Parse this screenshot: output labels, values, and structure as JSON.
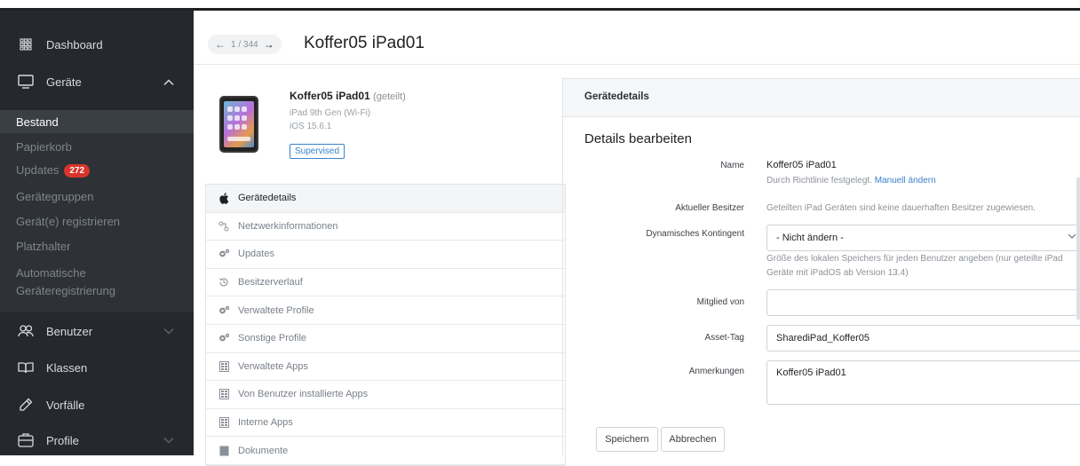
{
  "sidebar": {
    "dashboard": "Dashboard",
    "geraete": "Geräte",
    "sub": [
      {
        "label": "Bestand"
      },
      {
        "label": "Papierkorb"
      },
      {
        "label": "Updates",
        "badge": "272"
      },
      {
        "label": "Gerätegruppen"
      },
      {
        "label": "Gerät(e) registrieren"
      },
      {
        "label": "Platzhalter"
      },
      {
        "label": "Automatische"
      },
      {
        "label": "Geräteregistrierung"
      }
    ],
    "benutzer": "Benutzer",
    "klassen": "Klassen",
    "vorfaelle": "Vorfälle",
    "profile": "Profile"
  },
  "header": {
    "pager_count": "1 / 344",
    "title": "Koffer05 iPad01"
  },
  "device": {
    "name": "Koffer05 iPad01",
    "shared": "(geteilt)",
    "model": "iPad 9th Gen (Wi-Fi)",
    "os": "iOS 15.6.1",
    "badge": "Supervised"
  },
  "menu": [
    {
      "label": "Gerätedetails",
      "icon": "apple-icon"
    },
    {
      "label": "Netzwerkinformationen",
      "icon": "network-icon"
    },
    {
      "label": "Updates",
      "icon": "gears-icon"
    },
    {
      "label": "Besitzerverlauf",
      "icon": "history-icon"
    },
    {
      "label": "Verwaltete Profile",
      "icon": "gears-icon"
    },
    {
      "label": "Sonstige Profile",
      "icon": "gears-icon"
    },
    {
      "label": "Verwaltete Apps",
      "icon": "apps-icon"
    },
    {
      "label": "Von Benutzer installierte Apps",
      "icon": "apps-icon"
    },
    {
      "label": "Interne Apps",
      "icon": "apps-icon"
    },
    {
      "label": "Dokumente",
      "icon": "document-icon"
    }
  ],
  "panel": {
    "heading": "Gerätedetails",
    "section_title": "Details bearbeiten",
    "name_label": "Name",
    "name_value": "Koffer05 iPad01",
    "name_hint": "Durch Richtlinie festgelegt.",
    "name_link": "Manuell ändern",
    "owner_label": "Aktueller Besitzer",
    "owner_value": "Geteilten iPad Geräten sind keine dauerhaften Besitzer zugewiesen.",
    "quota_label": "Dynamisches Kontingent",
    "quota_value": "- Nicht ändern -",
    "quota_hint_1": "Größe des lokalen Speichers für jeden Benutzer angeben (nur geteilte iPad",
    "quota_hint_2": "Geräte mit iPadOS ab Version 13.4)",
    "member_label": "Mitglied von",
    "member_value": "",
    "asset_label": "Asset-Tag",
    "asset_value": "SharediPad_Koffer05",
    "notes_label": "Anmerkungen",
    "notes_value": "Koffer05 iPad01",
    "save": "Speichern",
    "cancel": "Abbrechen"
  }
}
